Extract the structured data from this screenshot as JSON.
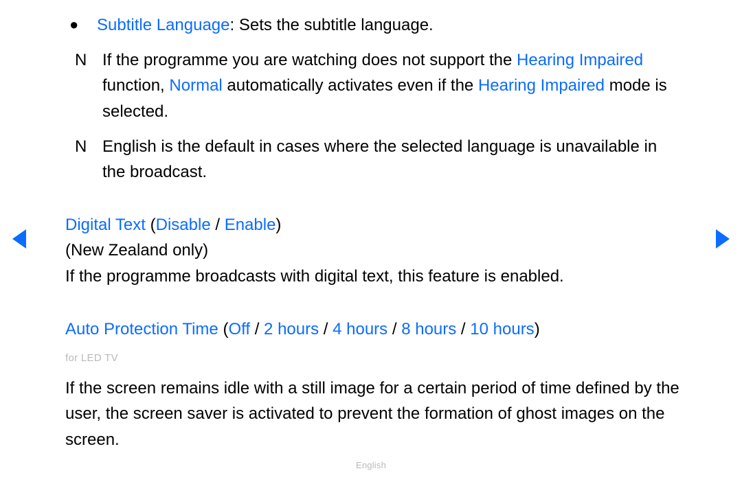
{
  "bullet": {
    "label": "Subtitle Language",
    "desc": ": Sets the subtitle language."
  },
  "notes": [
    {
      "marker": "N",
      "parts": [
        {
          "t": "If the programme you are watching does not support the "
        },
        {
          "t": "Hearing Impaired",
          "blue": true
        },
        {
          "t": " function, "
        },
        {
          "t": "Normal",
          "blue": true
        },
        {
          "t": " automatically activates even if the "
        },
        {
          "t": "Hearing Impaired",
          "blue": true
        },
        {
          "t": " mode is selected."
        }
      ]
    },
    {
      "marker": "N",
      "parts": [
        {
          "t": "English is the default in cases where the selected language is unavailable in the broadcast."
        }
      ]
    }
  ],
  "digital_text": {
    "label": "Digital Text",
    "opt1": "Disable",
    "opt2": "Enable",
    "region": "(New Zealand only)",
    "desc": "If the programme broadcasts with digital text, this feature is enabled."
  },
  "auto_protection": {
    "label": "Auto Protection Time",
    "opts": [
      "Off",
      "2 hours",
      "4 hours",
      "8 hours",
      "10 hours"
    ],
    "sub": "for LED TV",
    "desc": "If the screen remains idle with a still image for a certain period of time defined by the user, the screen saver is activated to prevent the formation of ghost images on the screen."
  },
  "footer": "English"
}
